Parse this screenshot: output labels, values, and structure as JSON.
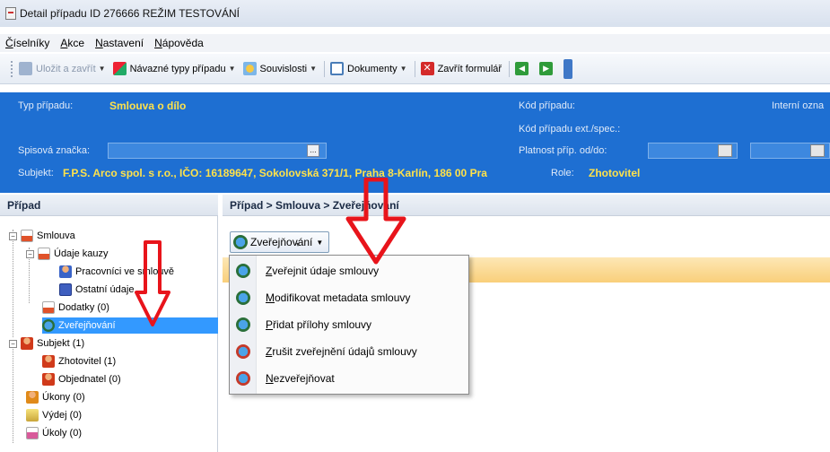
{
  "window": {
    "title": "Detail případu ID 276666 REŽIM TESTOVÁNÍ"
  },
  "menubar": {
    "items": [
      "Číselníky",
      "Akce",
      "Nastavení",
      "Nápověda"
    ]
  },
  "toolbar": {
    "save_close": "Uložit a zavřít",
    "related_types": "Návazné typy případu",
    "relations": "Souvislosti",
    "documents": "Dokumenty",
    "close_form": "Zavřít formulář"
  },
  "header": {
    "case_type_label": "Typ případu:",
    "case_type_value": "Smlouva o dílo",
    "case_code_label": "Kód případu:",
    "internal_label": "Interní ozna",
    "case_code_ext_label": "Kód případu ext./spec.:",
    "file_mark_label": "Spisová značka:",
    "validity_label": "Platnost příp. od/do:",
    "subject_label": "Subjekt:",
    "subject_value": "F.P.S. Arco spol. s r.o., IČO: 16189647, Sokolovská 371/1, Praha 8-Karlín, 186 00  Pra",
    "role_label": "Role:",
    "role_value": "Zhotovitel",
    "dots": "..."
  },
  "left_panel": {
    "title": "Případ",
    "tree": [
      {
        "label": "Smlouva"
      },
      {
        "label": "Údaje kauzy"
      },
      {
        "label": "Pracovníci ve smlouvě"
      },
      {
        "label": "Ostatní údaje"
      },
      {
        "label": "Dodatky (0)"
      },
      {
        "label": "Zveřejňování"
      },
      {
        "label": "Subjekt (1)"
      },
      {
        "label": "Zhotovitel (1)"
      },
      {
        "label": "Objednatel (0)"
      },
      {
        "label": "Úkony (0)"
      },
      {
        "label": "Výdej (0)"
      },
      {
        "label": "Úkoly (0)"
      }
    ]
  },
  "right_panel": {
    "breadcrumb": "Případ > Smlouva > Zveřejňování",
    "button_label": "Zveřejňování",
    "menu": [
      "Zveřejnit údaje smlouvy",
      "Modifikovat metadata smlouvy",
      "Přidat přílohy smlouvy",
      "Zrušit zveřejnění údajů smlouvy",
      "Nezveřejňovat"
    ]
  },
  "colors": {
    "header_bg": "#1e6fd2",
    "highlight": "#ffe24a",
    "arrow": "#e8141b",
    "selected": "#3399ff"
  }
}
